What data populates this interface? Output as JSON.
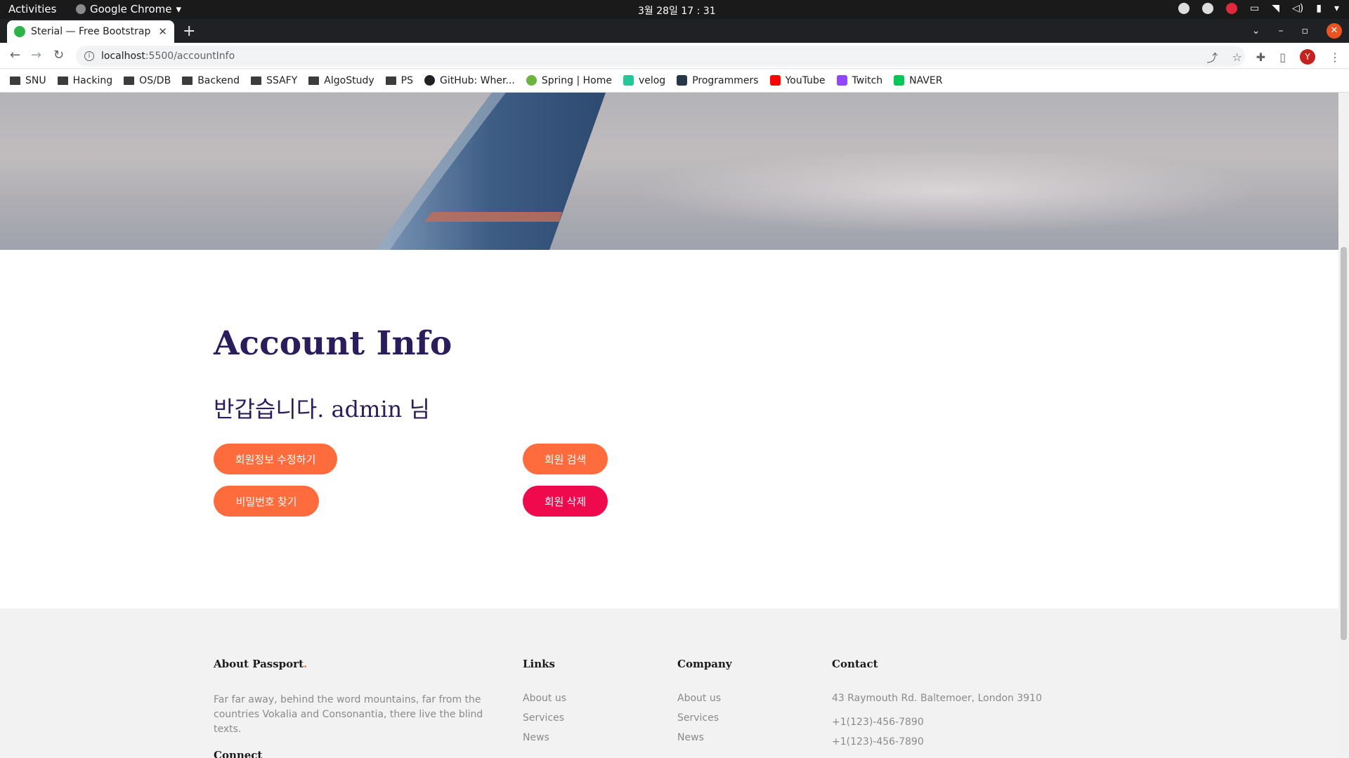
{
  "os_bar": {
    "activities": "Activities",
    "app_name": "Google Chrome",
    "clock": "3월 28일  17 : 31"
  },
  "browser": {
    "tab_title": "Sterial — Free Bootstrap",
    "url_host": "localhost",
    "url_path": ":5500/accountInfo",
    "profile_initial": "Y"
  },
  "bookmarks": [
    {
      "label": "SNU",
      "icon": "folder-icon"
    },
    {
      "label": "Hacking",
      "icon": "folder-icon"
    },
    {
      "label": "OS/DB",
      "icon": "folder-icon"
    },
    {
      "label": "Backend",
      "icon": "folder-icon"
    },
    {
      "label": "SSAFY",
      "icon": "folder-icon"
    },
    {
      "label": "AlgoStudy",
      "icon": "folder-icon"
    },
    {
      "label": "PS",
      "icon": "folder-icon"
    },
    {
      "label": "GitHub: Wher...",
      "icon": "github-icon",
      "color": "#202124"
    },
    {
      "label": "Spring | Home",
      "icon": "spring-icon",
      "color": "#6db33f"
    },
    {
      "label": "velog",
      "icon": "velog-icon",
      "color": "#20c997"
    },
    {
      "label": "Programmers",
      "icon": "programmers-icon",
      "color": "#263747"
    },
    {
      "label": "YouTube",
      "icon": "youtube-icon",
      "color": "#ff0000"
    },
    {
      "label": "Twitch",
      "icon": "twitch-icon",
      "color": "#9146ff"
    },
    {
      "label": "NAVER",
      "icon": "naver-icon",
      "color": "#03c75a"
    }
  ],
  "page": {
    "title": "Account Info",
    "welcome": "반갑습니다. admin 님",
    "buttons": {
      "edit_profile": "회원정보 수정하기",
      "find_password": "비밀번호 찾기",
      "search_member": "회원 검색",
      "delete_member": "회원 삭제"
    }
  },
  "footer": {
    "about_title": "About Passport",
    "about_text": "Far far away, behind the word mountains, far from the countries Vokalia and Consonantia, there live the blind texts.",
    "connect_title": "Connect",
    "links_title": "Links",
    "links": [
      "About us",
      "Services",
      "News"
    ],
    "company_title": "Company",
    "company_links": [
      "About us",
      "Services",
      "News"
    ],
    "contact_title": "Contact",
    "contact_address": "43 Raymouth Rd. Baltemoer, London 3910",
    "contact_phone_1": "+1(123)-456-7890",
    "contact_phone_2": "+1(123)-456-7890"
  },
  "colors": {
    "heading": "#2b1c5c",
    "orange_button": "#fe6b3d",
    "pink_button": "#ee0a4d"
  }
}
